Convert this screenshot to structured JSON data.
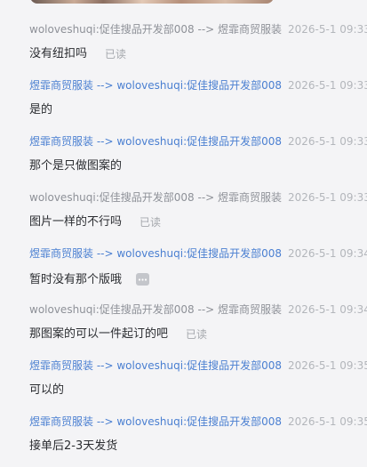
{
  "messages": [
    {
      "direction": "in",
      "route": "woloveshuqi:促佳搜品开发部008 --> 煜霏商贸服装",
      "time": "2026-5-1 09:33:",
      "text": "没有纽扣吗",
      "read_status": "已读"
    },
    {
      "direction": "out",
      "route": "煜霏商贸服装 --> woloveshuqi:促佳搜品开发部008",
      "time": "2026-5-1 09:33:",
      "text": "是的"
    },
    {
      "direction": "out",
      "route": "煜霏商贸服装 --> woloveshuqi:促佳搜品开发部008",
      "time": "2026-5-1 09:33:",
      "text": "那个是只做图案的"
    },
    {
      "direction": "in",
      "route": "woloveshuqi:促佳搜品开发部008 --> 煜霏商贸服装",
      "time": "2026-5-1 09:33:",
      "text": "图片一样的不行吗",
      "read_status": "已读"
    },
    {
      "direction": "out",
      "route": "煜霏商贸服装 --> woloveshuqi:促佳搜品开发部008",
      "time": "2026-5-1 09:34:",
      "text": "暂时没有那个版哦",
      "badge_icon": "more-dots-icon"
    },
    {
      "direction": "in",
      "route": "woloveshuqi:促佳搜品开发部008 --> 煜霏商贸服装",
      "time": "2026-5-1 09:34:",
      "text": "那图案的可以一件起订的吧",
      "read_status": "已读"
    },
    {
      "direction": "out",
      "route": "煜霏商贸服装 --> woloveshuqi:促佳搜品开发部008",
      "time": "2026-5-1 09:35:",
      "text": "可以的"
    },
    {
      "direction": "out",
      "route": "煜霏商贸服装 --> woloveshuqi:促佳搜品开发部008",
      "time": "2026-5-1 09:35:",
      "text": "接单后2-3天发货"
    }
  ],
  "colors": {
    "incoming_route": "#8e9198",
    "outgoing_route": "#4a7fd1",
    "timestamp": "#b3b6bb",
    "message_text": "#2b2d31",
    "background": "#f4f4f6"
  }
}
